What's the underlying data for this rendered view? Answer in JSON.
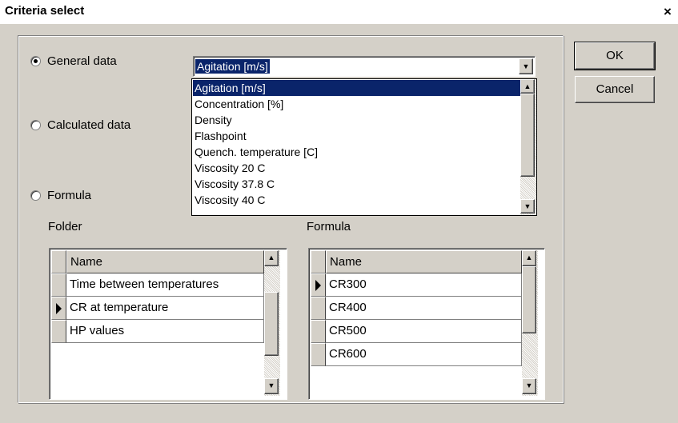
{
  "window": {
    "title": "Criteria select",
    "close_glyph": "×"
  },
  "buttons": {
    "ok": "OK",
    "cancel": "Cancel"
  },
  "radios": [
    {
      "label": "General data",
      "checked": true
    },
    {
      "label": "Calculated data",
      "checked": false
    },
    {
      "label": "Formula",
      "checked": false
    }
  ],
  "combo": {
    "value": "Agitation [m/s]",
    "options": [
      "Agitation [m/s]",
      "Concentration [%]",
      "Density",
      "Flashpoint",
      "Quench. temperature [C]",
      "Viscosity 20 C",
      "Viscosity 37.8 C",
      "Viscosity 40 C"
    ],
    "selected_index": 0
  },
  "folder": {
    "label": "Folder",
    "header": "Name",
    "rows": [
      "Time between temperatures",
      "CR at temperature",
      "HP values"
    ],
    "current_row": 1
  },
  "formula": {
    "label": "Formula",
    "header": "Name",
    "rows": [
      "CR300",
      "CR400",
      "CR500",
      "CR600"
    ],
    "current_row": 0
  },
  "icons": {
    "close": "close-icon",
    "dropdown": "chevron-down-icon",
    "scroll_up": "scroll-up-icon",
    "scroll_down": "scroll-down-icon",
    "row_pointer": "row-pointer-icon"
  }
}
